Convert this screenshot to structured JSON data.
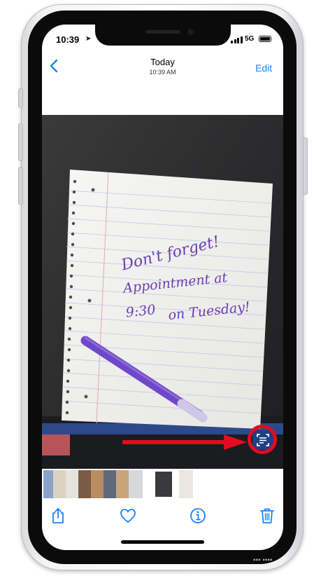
{
  "status_bar": {
    "time": "10:39",
    "network": "5G"
  },
  "nav": {
    "title": "Today",
    "subtitle": "10:39 AM",
    "edit_label": "Edit"
  },
  "note": {
    "line1": "Don't forget!",
    "line2": "Appointment at",
    "line3": "9:30",
    "line4": "on Tuesday!"
  },
  "colors": {
    "accent": "#1a84ff",
    "highlight": "#e10d1e",
    "ink": "#6c3db4"
  },
  "icons": {
    "back": "chevron-left-icon",
    "live_text": "live-text-icon",
    "share": "share-icon",
    "favorite": "heart-icon",
    "info": "info-icon",
    "delete": "trash-icon"
  }
}
